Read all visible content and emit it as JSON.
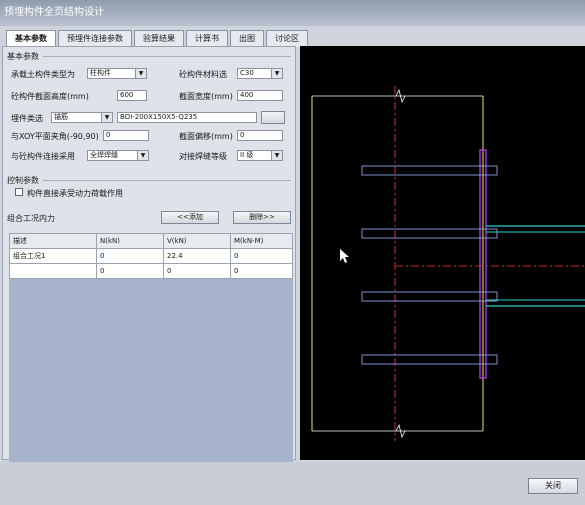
{
  "window": {
    "title": "预埋构件全页结构设计"
  },
  "tabs": [
    "基本参数",
    "预埋件连接参数",
    "验算结果",
    "计算书",
    "出图",
    "讨论区"
  ],
  "basic": {
    "group_label": "基本参数",
    "member_type_label": "承载土构件类型为",
    "member_type_value": "柱构件",
    "concrete_grade_label": "砼构件材料选",
    "concrete_grade_value": "C30",
    "section_height_label": "砼构件截面高度(mm)",
    "section_height_value": "600",
    "section_width_label": "截面宽度(mm)",
    "section_width_value": "400",
    "embed_type_label": "埋件类选",
    "embed_type_value": "锚筋",
    "embed_spec_value": "BOI-200X150X5-Q235",
    "angle_label": "与XOY平面夹角(-90,90)",
    "angle_value": "0",
    "offset_label": "截面偏移(mm)",
    "offset_value": "0",
    "connection_label": "与砼构件连接采用",
    "connection_value": "全焊焊缝",
    "weld_grade_label": "对接焊缝等级",
    "weld_grade_value": "II 级"
  },
  "control": {
    "group_label": "控制参数",
    "checkbox_label": "构件直接承受动力荷载作用"
  },
  "loads": {
    "group_label": "组合工况内力",
    "add_button": "<<添加",
    "delete_button": "删除>>",
    "columns": [
      "描述",
      "N(kN)",
      "V(kN)",
      "M(kN-M)"
    ],
    "rows": [
      [
        "组合工况1",
        "0",
        "22.4",
        "0"
      ],
      [
        "",
        "0",
        "0",
        "0"
      ]
    ]
  },
  "footer": {
    "close_button": "关闭"
  },
  "colors": {
    "canvas": "#000000",
    "plate": "#c83cff",
    "anchor": "#9eb4ff",
    "column": "#e8e85a",
    "axis": "#ff3b3b",
    "beam": "#2ccfc7"
  }
}
